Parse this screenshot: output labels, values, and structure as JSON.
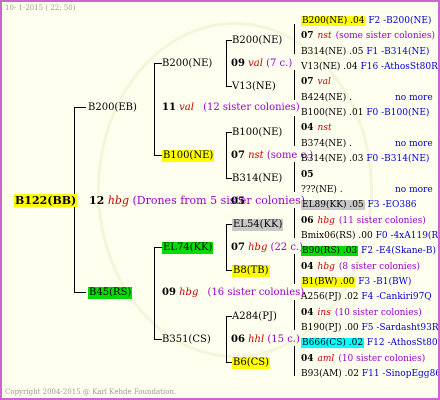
{
  "header": {
    "date": "10-  1-2015 ( 22: 50)"
  },
  "footer": {
    "copyright": "Copyright 2004-2015 @ Karl Kehde Foundation."
  },
  "root": {
    "name": "B122(BB)",
    "gen": "12",
    "tag": "hbg",
    "note": "(Drones from 5 sister colonies)"
  },
  "g1": {
    "upper": {
      "name": "B200(EB)",
      "gen": "11",
      "tag": "val",
      "note": "(12 sister colonies)"
    },
    "lower": {
      "name": "B45(RS)",
      "gen": "09",
      "tag": "hbg",
      "note": "(16 sister colonies)"
    }
  },
  "g2": {
    "a": {
      "name": "B200(NE)"
    },
    "b": {
      "name": "B100(NE)",
      "gen": "07",
      "tag": "nst",
      "note": "(some c.)"
    },
    "c": {
      "name": "EL74(KK)",
      "gen": "07",
      "tag": "hbg",
      "note": "(22 c.)"
    },
    "d": {
      "name": "B351(CS)",
      "gen": "06",
      "tag": "hhl",
      "note": "(15 c.)"
    }
  },
  "g3": {
    "a1": {
      "name": "B200(NE)",
      "gen": "09",
      "tag": "val",
      "note": "(7 c.)"
    },
    "a2": {
      "name": "V13(NE)"
    },
    "b1": {
      "name": "B100(NE)"
    },
    "b2": {
      "name": "B314(NE)",
      "gen": "05"
    },
    "c1": {
      "name": "EL54(KK)"
    },
    "c2": {
      "name": "B8(TB)"
    },
    "d1": {
      "name": "A284(PJ)",
      "gen": "04",
      "tag": "ins",
      "note": "(10 sister colonies)"
    },
    "d2": {
      "name": "B6(CS)"
    }
  },
  "g4": [
    {
      "left": "B200(NE) .04",
      "right": "F2 -B200(NE)"
    },
    {
      "gen": "07",
      "tag": "nst",
      "note": "(some sister colonies)"
    },
    {
      "left": "B314(NE) .05",
      "right": "F1 -B314(NE)"
    },
    {
      "left": "V13(NE) .04",
      "right": "F16 -AthosSt80R"
    },
    {
      "gen": "07",
      "tag": "val"
    },
    {
      "left": "B424(NE) .",
      "right": "no more"
    },
    {
      "left": "B100(NE) .01",
      "right": "F0 -B100(NE)"
    },
    {
      "gen": "04",
      "tag": "nst"
    },
    {
      "left": "B374(NE) .",
      "right": "no more"
    },
    {
      "left": "B314(NE) .03",
      "right": "F0 -B314(NE)"
    },
    {
      "gen": "05"
    },
    {
      "left": "???(NE) .",
      "right": "no more"
    },
    {
      "left": "EL89(KK) .05",
      "right": "F3 -EO386"
    },
    {
      "gen": "06",
      "tag": "hbg",
      "note": "(11 sister colonies)"
    },
    {
      "left": "Bmix06(RS) .00",
      "right": "F0 -4xA119(RS)"
    },
    {
      "left": "B90(RS) .03",
      "right": "F2 -E4(Skane-B)"
    },
    {
      "gen": "04",
      "tag": "hbg",
      "note": "(8 sister colonies)"
    },
    {
      "left": "B1(BW) .00",
      "right": "F3 -B1(BW)"
    },
    {
      "left": "A256(PJ) .02",
      "right": "F4 -Cankiri97Q"
    },
    {
      "gen": "04",
      "tag": "ins",
      "note": "(10 sister colonies)"
    },
    {
      "left": "B190(PJ) .00",
      "right": "F5 -Sardasht93R"
    },
    {
      "left": "B666(CS) .02",
      "right": "F12 -AthosSt80R"
    },
    {
      "gen": "04",
      "tag": "aml",
      "note": "(10 sister colonies)"
    },
    {
      "left": "B93(AM) .02",
      "right": "F11 -SinopEgg86R"
    }
  ]
}
